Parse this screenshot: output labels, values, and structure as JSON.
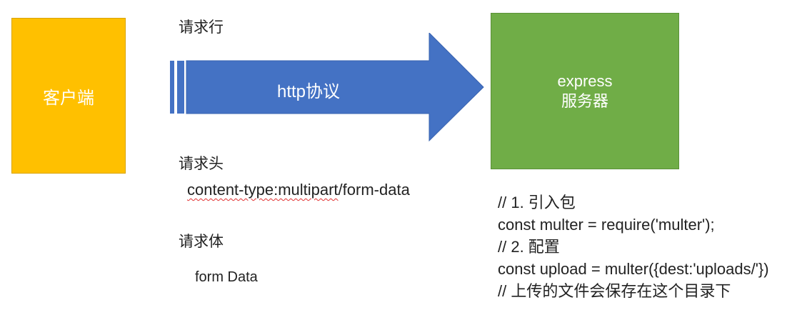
{
  "client": {
    "label": "客户端"
  },
  "server": {
    "line1": "express",
    "line2": "服务器"
  },
  "arrow": {
    "label": "http协议"
  },
  "request_line_label": "请求行",
  "request_header": {
    "label": "请求头",
    "content_type_prefix": "content-type:multipart",
    "content_type_suffix": "/form-data"
  },
  "request_body": {
    "label": "请求体",
    "value": "form Data"
  },
  "code": {
    "lines": [
      "// 1. 引入包",
      "const multer = require('multer');",
      "// 2. 配置",
      "const upload = multer({dest:'uploads/'})",
      "// 上传的文件会保存在这个目录下"
    ]
  },
  "colors": {
    "client": "#FFC000",
    "server": "#70AD47",
    "arrow": "#4472C4"
  }
}
